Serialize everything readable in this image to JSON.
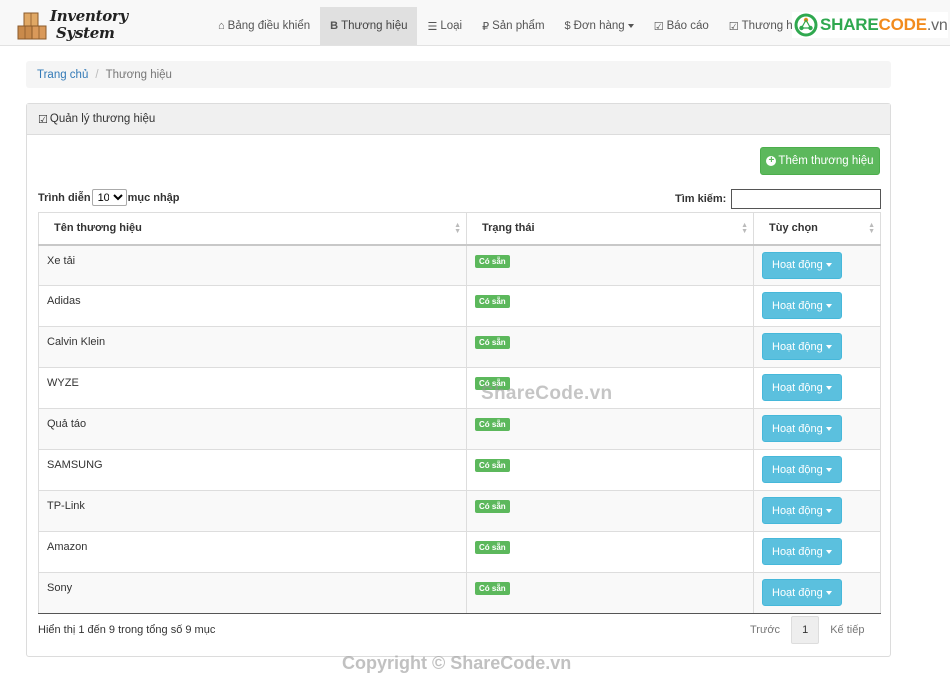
{
  "brand": {
    "line1": "Inventory",
    "line2": "System",
    "icon": "boxes-logo-icon"
  },
  "nav": {
    "items": [
      {
        "label": "Bảng điều khiển",
        "icon": "home-icon",
        "glyph": "⌂",
        "active": false,
        "dropdown": false
      },
      {
        "label": "Thương hiệu",
        "icon": "bold-b-icon",
        "glyph": "B",
        "active": true,
        "dropdown": false
      },
      {
        "label": "Loại",
        "icon": "list-icon",
        "glyph": "☰",
        "active": false,
        "dropdown": false
      },
      {
        "label": "Sản phẩm",
        "icon": "ruble-icon",
        "glyph": "₽",
        "active": false,
        "dropdown": false
      },
      {
        "label": "Đơn hàng",
        "icon": "dollar-icon",
        "glyph": "$",
        "active": false,
        "dropdown": true
      },
      {
        "label": "Báo cáo",
        "icon": "check-square-icon",
        "glyph": "☑",
        "active": false,
        "dropdown": false
      },
      {
        "label": "Thương hiệ",
        "icon": "check-square-icon",
        "glyph": "☑",
        "active": false,
        "dropdown": false
      }
    ]
  },
  "watermark_logo": {
    "share": "SHARE",
    "code": "CODE",
    "vn": ".vn"
  },
  "breadcrumb": {
    "home": "Trang chủ",
    "current": "Thương hiệu"
  },
  "panel": {
    "title": "Quản lý thương hiệu",
    "add_button": "Thêm thương hiệu",
    "length_prefix": "Trình diễn",
    "length_value": "10",
    "length_suffix": "mục nhập",
    "search_label": "Tìm kiếm:",
    "search_value": ""
  },
  "table": {
    "columns": [
      "Tên thương hiệu",
      "Trạng thái",
      "Tùy chọn"
    ],
    "rows": [
      {
        "name": "Xe tải",
        "status": "Có sẵn",
        "action": "Hoạt động"
      },
      {
        "name": "Adidas",
        "status": "Có sẵn",
        "action": "Hoạt động"
      },
      {
        "name": "Calvin Klein",
        "status": "Có sẵn",
        "action": "Hoạt động"
      },
      {
        "name": "WYZE",
        "status": "Có sẵn",
        "action": "Hoạt động"
      },
      {
        "name": "Quả táo",
        "status": "Có sẵn",
        "action": "Hoạt động"
      },
      {
        "name": "SAMSUNG",
        "status": "Có sẵn",
        "action": "Hoạt động"
      },
      {
        "name": "TP-Link",
        "status": "Có sẵn",
        "action": "Hoạt động"
      },
      {
        "name": "Amazon",
        "status": "Có sẵn",
        "action": "Hoạt động"
      },
      {
        "name": "Sony",
        "status": "Có sẵn",
        "action": "Hoạt động"
      }
    ]
  },
  "footer": {
    "info": "Hiển thị 1 đến 9 trong tổng số 9 mục",
    "prev": "Trước",
    "page": "1",
    "next": "Kế tiếp"
  },
  "watermarks": {
    "middle": "ShareCode.vn",
    "bottom": "Copyright © ShareCode.vn"
  },
  "colors": {
    "success": "#5cb85c",
    "info": "#5bc0de",
    "link": "#337ab7"
  }
}
